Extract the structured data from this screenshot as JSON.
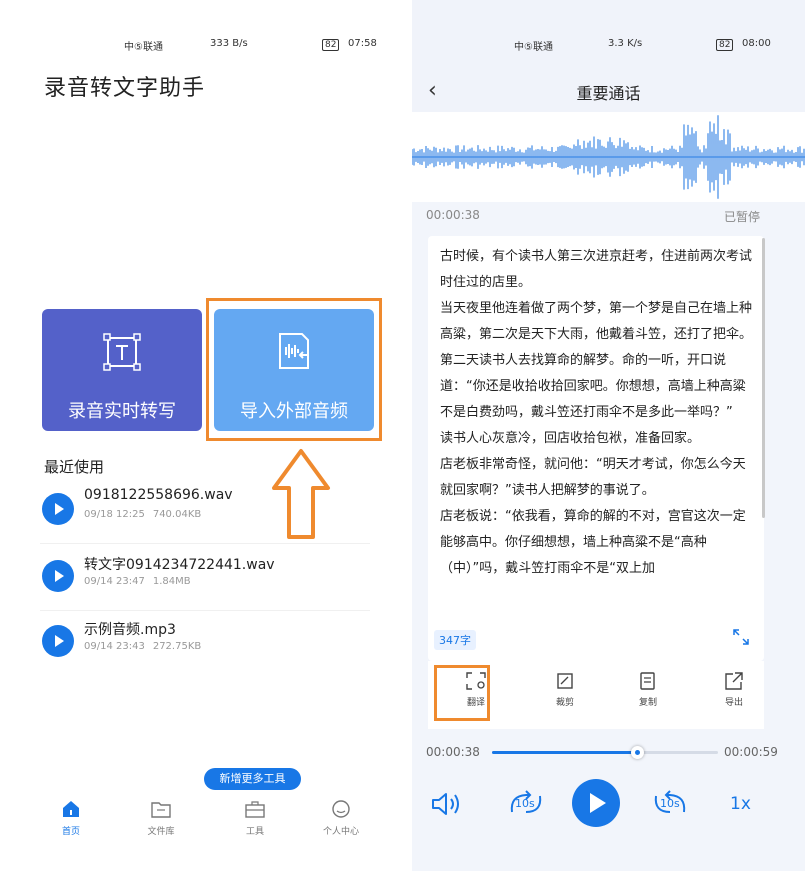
{
  "left": {
    "status": {
      "carrier": "中⑤联通",
      "net_speed": "333 B/s",
      "battery": "82",
      "time": "07:58"
    },
    "app_title": "录音转文字助手",
    "tiles": [
      {
        "label": "录音实时转写",
        "color": "#5461c9"
      },
      {
        "label": "导入外部音频",
        "color": "#64a8f2"
      }
    ],
    "recent_title": "最近使用",
    "files": [
      {
        "name": "0918122558696.wav",
        "date": "09/18 12:25",
        "size": "740.04KB"
      },
      {
        "name": "转文字0914234722441.wav",
        "date": "09/14 23:47",
        "size": "1.84MB"
      },
      {
        "name": "示例音频.mp3",
        "date": "09/14 23:43",
        "size": "272.75KB"
      }
    ],
    "more_tools": "新增更多工具",
    "nav": [
      {
        "label": "首页",
        "icon": "home-icon"
      },
      {
        "label": "文件库",
        "icon": "folder-icon"
      },
      {
        "label": "工具",
        "icon": "toolbox-icon"
      },
      {
        "label": "个人中心",
        "icon": "smiley-icon"
      }
    ]
  },
  "right": {
    "status": {
      "carrier": "中⑤联通",
      "net_speed": "3.3 K/s",
      "battery": "82",
      "time": "08:00"
    },
    "title": "重要通话",
    "back_icon": "back-chevron-icon",
    "current_time": "00:00:38",
    "state": "已暂停",
    "paragraphs": [
      "古时候，有个读书人第三次进京赶考，住进前两次考试时住过的店里。",
      "当天夜里他连着做了两个梦，第一个梦是自己在墙上种高粱，第二次是天下大雨，他戴着斗笠，还打了把伞。",
      "第二天读书人去找算命的解梦。命的一听，开口说道：“你还是收拾收拾回家吧。你想想，高墙上种高粱不是白费劲吗，戴斗笠还打雨伞不是多此一举吗？”",
      "读书人心灰意冷，回店收拾包袱，准备回家。",
      "店老板非常奇怪，就问他：“明天才考试，你怎么今天就回家啊？”读书人把解梦的事说了。",
      "店老板说：“依我看，算命的解的不对，宫官这次一定能够高中。你仔细想想，墙上种高粱不是“高种（中）”吗，戴斗笠打雨伞不是“双上加"
    ],
    "char_count": "347字",
    "actions": [
      {
        "label": "翻译",
        "icon": "translate-icon"
      },
      {
        "label": "裁剪",
        "icon": "crop-icon"
      },
      {
        "label": "复制",
        "icon": "copy-icon"
      },
      {
        "label": "导出",
        "icon": "export-icon"
      }
    ],
    "player": {
      "elapsed": "00:00:38",
      "total": "00:00:59",
      "progress": 0.64,
      "rewind": "10s",
      "forward": "10s",
      "speed": "1x"
    }
  },
  "colors": {
    "accent": "#1877e6",
    "highlight": "#ef8a2e"
  }
}
